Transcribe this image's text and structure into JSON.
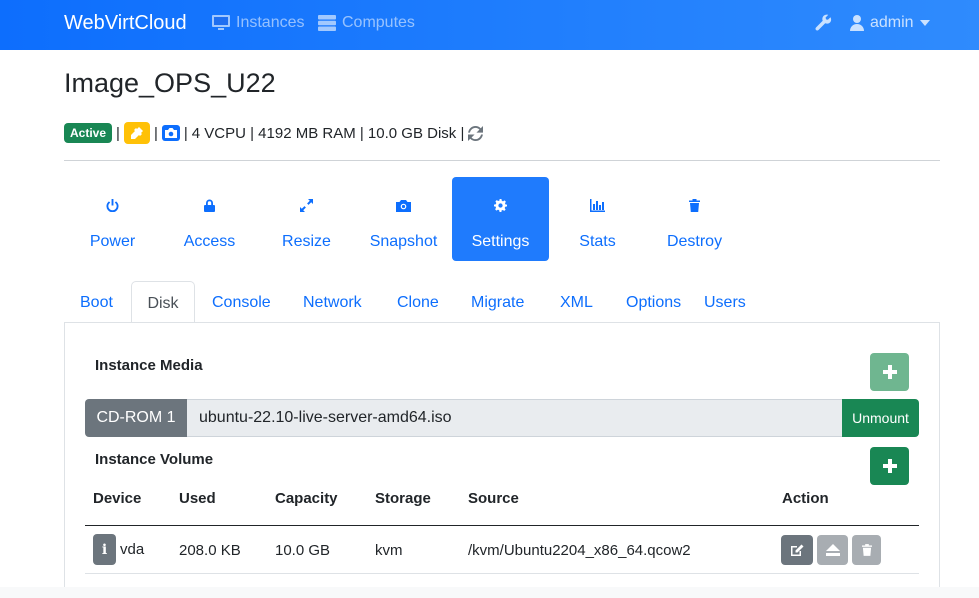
{
  "navbar": {
    "brand": "WebVirtCloud",
    "items": [
      {
        "label": "Instances",
        "icon": "desktop-icon"
      },
      {
        "label": "Computes",
        "icon": "server-icon"
      }
    ],
    "settings_icon": "wrench-icon",
    "user": "admin",
    "user_icon": "user-icon"
  },
  "instance": {
    "name": "Image_OPS_U22",
    "status": "Active",
    "status_color": "#198754",
    "specs": "4 VCPU | 4192 MB RAM | 10.0 GB Disk |"
  },
  "actions": [
    {
      "label": "Power",
      "icon": "power-icon"
    },
    {
      "label": "Access",
      "icon": "lock-icon"
    },
    {
      "label": "Resize",
      "icon": "expand-icon"
    },
    {
      "label": "Snapshot",
      "icon": "camera-icon"
    },
    {
      "label": "Settings",
      "icon": "gear-icon",
      "active": true
    },
    {
      "label": "Stats",
      "icon": "bar-chart-icon"
    },
    {
      "label": "Destroy",
      "icon": "trash-icon"
    }
  ],
  "tabs": [
    {
      "label": "Boot"
    },
    {
      "label": "Disk",
      "active": true
    },
    {
      "label": "Console"
    },
    {
      "label": "Network"
    },
    {
      "label": "Clone"
    },
    {
      "label": "Migrate"
    },
    {
      "label": "XML"
    },
    {
      "label": "Options"
    },
    {
      "label": "Users"
    }
  ],
  "media": {
    "title": "Instance Media",
    "device_label": "CD-ROM 1",
    "iso": "ubuntu-22.10-live-server-amd64.iso",
    "unmount_label": "Unmount"
  },
  "volume": {
    "title": "Instance Volume",
    "columns": [
      "Device",
      "Used",
      "Capacity",
      "Storage",
      "Source",
      "Action"
    ],
    "rows": [
      {
        "device": "vda",
        "used": "208.0 KB",
        "capacity": "10.0 GB",
        "storage": "kvm",
        "source": "/kvm/Ubuntu2204_x86_64.qcow2"
      }
    ]
  },
  "colors": {
    "primary": "#0d6efd",
    "success": "#198754",
    "secondary": "#6c757d",
    "warning": "#ffc107"
  }
}
